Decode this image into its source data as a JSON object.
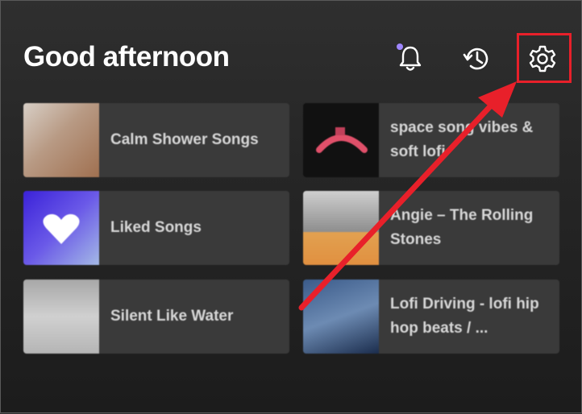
{
  "header": {
    "greeting": "Good afternoon",
    "icons": [
      "bell-icon",
      "history-icon",
      "settings-gear-icon"
    ],
    "notification_dot_color": "#9f86ff"
  },
  "tiles": [
    {
      "title": "Calm Shower Songs"
    },
    {
      "title": "space song vibes & soft lofi"
    },
    {
      "title": "Liked Songs"
    },
    {
      "title": "Angie – The Rolling Stones"
    },
    {
      "title": "Silent Like Water"
    },
    {
      "title": "Lofi Driving - lofi hip hop beats / ..."
    }
  ],
  "annotation": {
    "highlight_color": "#e8202a",
    "target": "settings-gear-icon"
  }
}
